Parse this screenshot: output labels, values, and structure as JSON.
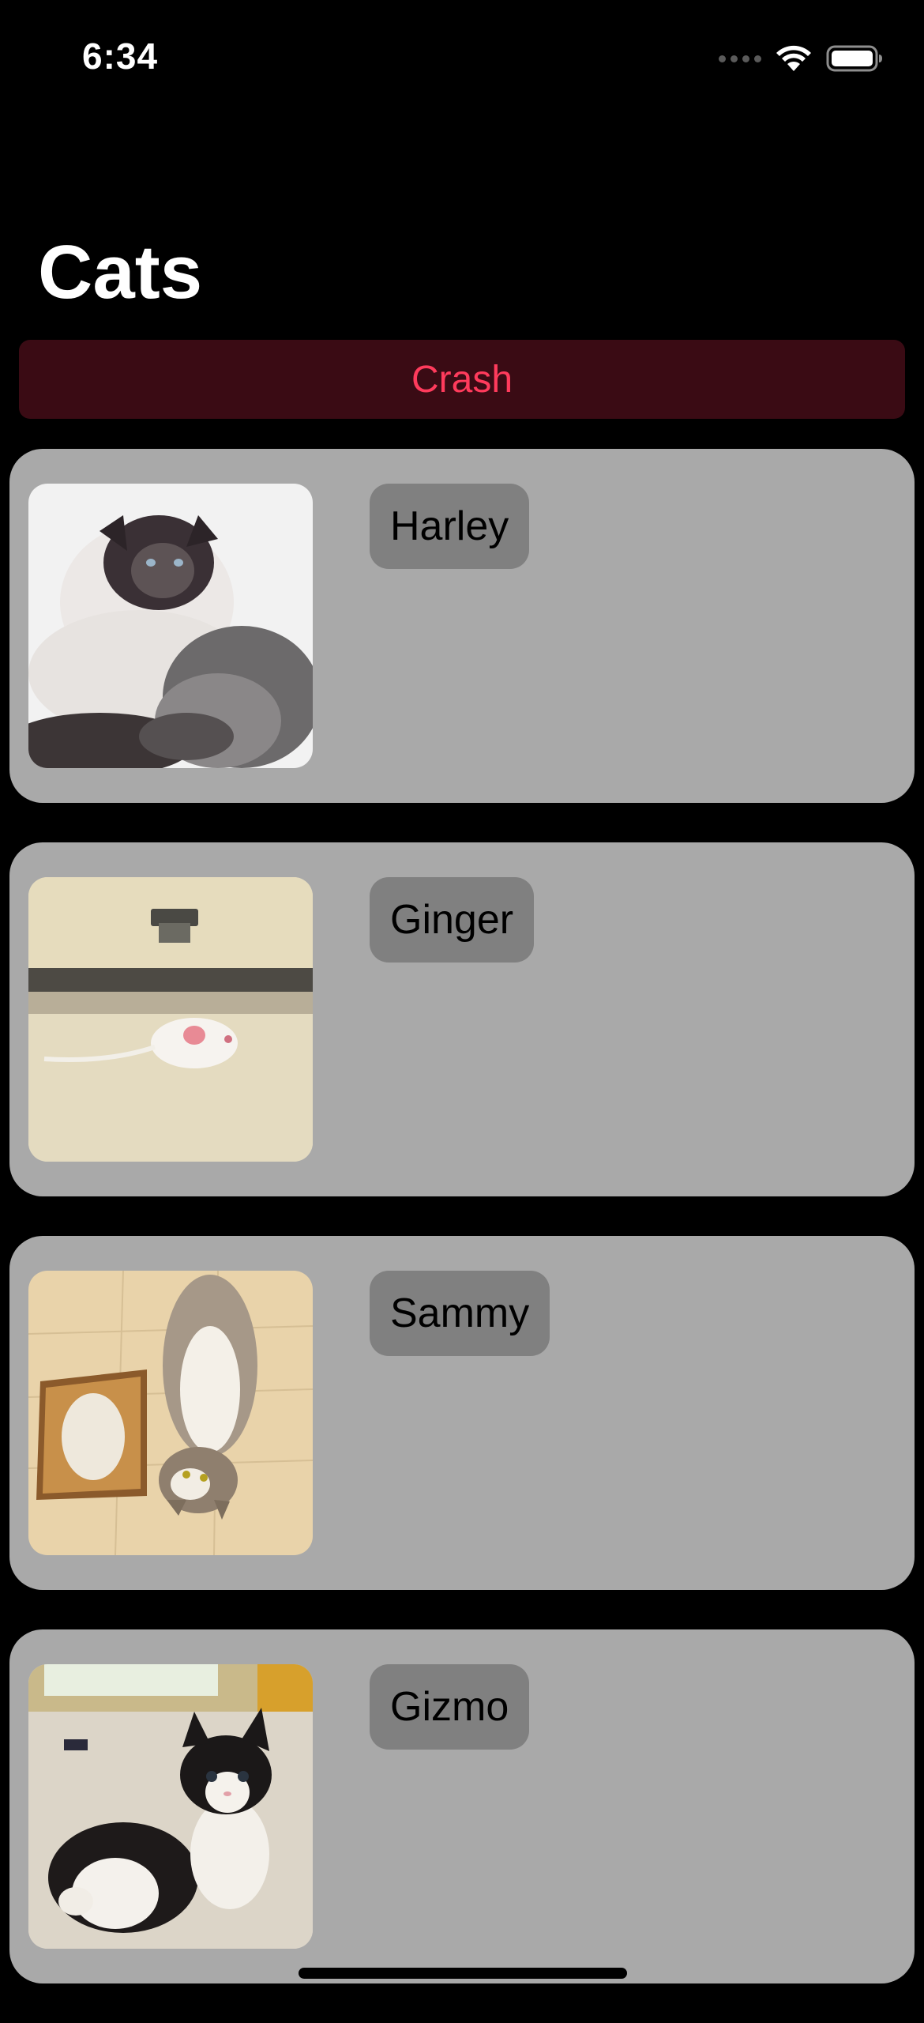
{
  "status_bar": {
    "time": "6:34"
  },
  "header": {
    "title": "Cats"
  },
  "crash_button": {
    "label": "Crash"
  },
  "cats": [
    {
      "name": "Harley"
    },
    {
      "name": "Ginger"
    },
    {
      "name": "Sammy"
    },
    {
      "name": "Gizmo"
    }
  ],
  "colors": {
    "background": "#000000",
    "card": "#a9a9a9",
    "name_tag": "#808080",
    "crash_bg": "#3a0b14",
    "crash_text": "#ff3b5c"
  },
  "icons": {
    "signal": "cellular-signal-icon",
    "wifi": "wifi-icon",
    "battery": "battery-icon"
  }
}
